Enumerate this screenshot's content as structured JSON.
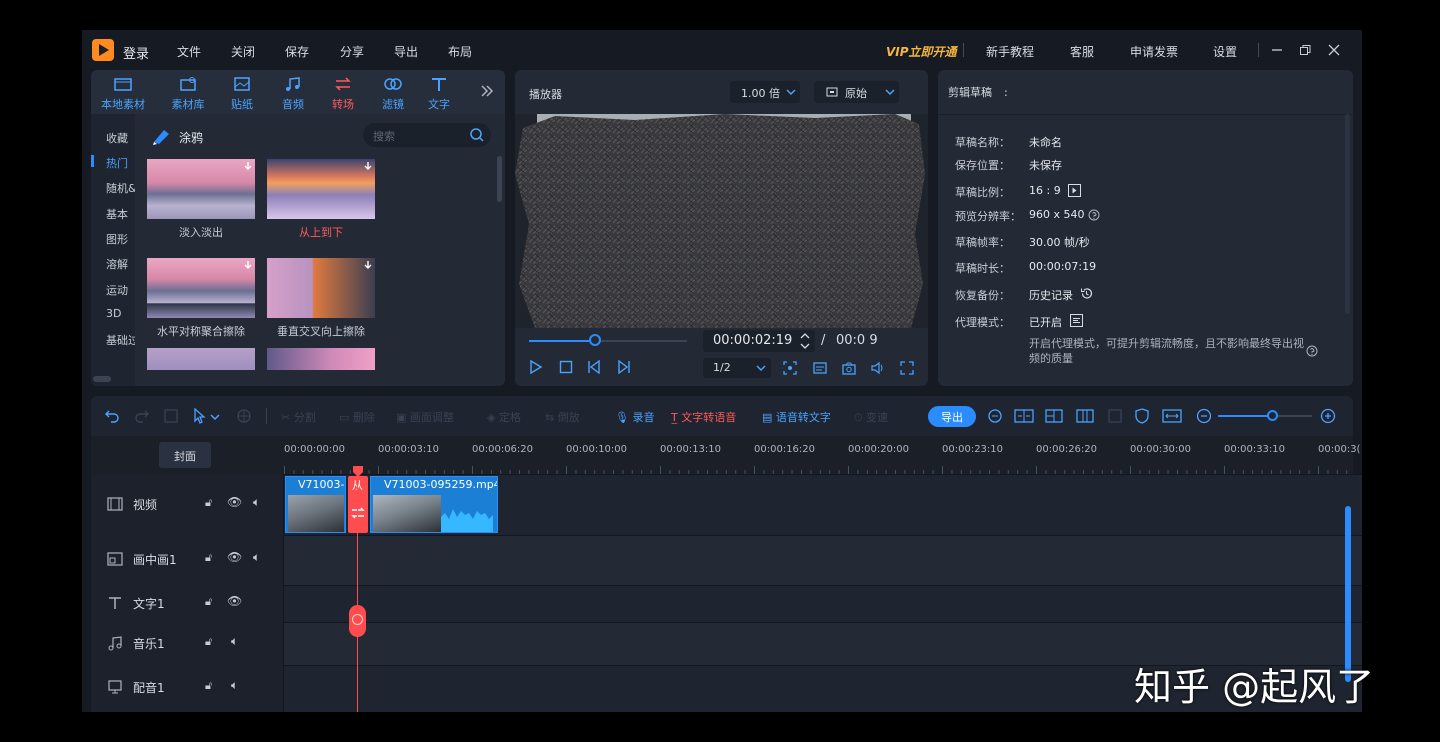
{
  "titlebar": {
    "login": "登录",
    "menu": [
      "文件",
      "关闭",
      "保存",
      "分享",
      "导出",
      "布局"
    ],
    "vip": "VIP立即开通",
    "right_links": [
      "新手教程",
      "客服",
      "申请发票",
      "设置"
    ]
  },
  "media_tabs": [
    "本地素材",
    "素材库",
    "贴纸",
    "音频",
    "转场",
    "滤镜",
    "文字"
  ],
  "categories": [
    "收藏",
    "热门",
    "随机&",
    "基本",
    "图形",
    "溶解",
    "运动",
    "3D",
    "基础过"
  ],
  "category_title": "涂鸦",
  "search_placeholder": "搜索",
  "transitions": [
    {
      "name": "淡入淡出"
    },
    {
      "name": "从上到下"
    },
    {
      "name": "水平对称聚合擦除"
    },
    {
      "name": "垂直交叉向上擦除"
    }
  ],
  "player": {
    "title": "播放器",
    "speed": "1.00 倍",
    "ratio": "原始",
    "current_time": "00:00:02:19",
    "separator": "/",
    "total_time": "00:0 9",
    "quality": "1/2",
    "progress": 0.42
  },
  "draft": {
    "title": "剪辑草稿",
    "colon": ":",
    "fields": [
      {
        "label": "草稿名称：",
        "value": "未命名"
      },
      {
        "label": "保存位置：",
        "value": "未保存"
      },
      {
        "label": "草稿比例：",
        "value": "16 : 9"
      },
      {
        "label": "预览分辨率：",
        "value": "960 x 540"
      },
      {
        "label": "草稿帧率：",
        "value": "30.00 帧/秒"
      },
      {
        "label": "草稿时长：",
        "value": "00:00:07:19"
      },
      {
        "label": "恢复备份：",
        "value": "历史记录"
      },
      {
        "label": "代理模式：",
        "value": "已开启"
      }
    ],
    "proxy_note": "开启代理模式，可提升剪辑流畅度，且不影响最终导出视频的质量"
  },
  "toolbar": {
    "dim_labels": [
      "分割",
      "删除",
      "画面调整",
      "定格",
      "倒放",
      "变速"
    ],
    "record": "录音",
    "tts": "文字转语音",
    "stt": "语音转文字",
    "export": "导出"
  },
  "timeline": {
    "cover": "封面",
    "ticks": [
      "00:00:00:00",
      "00:00:03:10",
      "00:00:06:20",
      "00:00:10:00",
      "00:00:13:10",
      "00:00:16:20",
      "00:00:20:00",
      "00:00:23:10",
      "00:00:26:20",
      "00:00:30:00",
      "00:00:33:10",
      "00:00:3("
    ],
    "tracks": [
      {
        "name": "视频",
        "icon": "film-icon"
      },
      {
        "name": "画中画1",
        "icon": "pip-icon"
      },
      {
        "name": "文字1",
        "icon": "text-icon"
      },
      {
        "name": "音乐1",
        "icon": "music-icon"
      },
      {
        "name": "配音1",
        "icon": "dubbing-icon"
      }
    ],
    "clips": [
      {
        "label": "V71003-("
      },
      {
        "label": "从"
      },
      {
        "label": "V71003-095259.mp4"
      }
    ]
  },
  "watermark": "知乎 @起风了",
  "colors": {
    "accent": "#2a8cff",
    "playhead": "#ff4d4f",
    "vip": "#f5b640",
    "bg": "#161a22",
    "panel": "#232a36"
  }
}
